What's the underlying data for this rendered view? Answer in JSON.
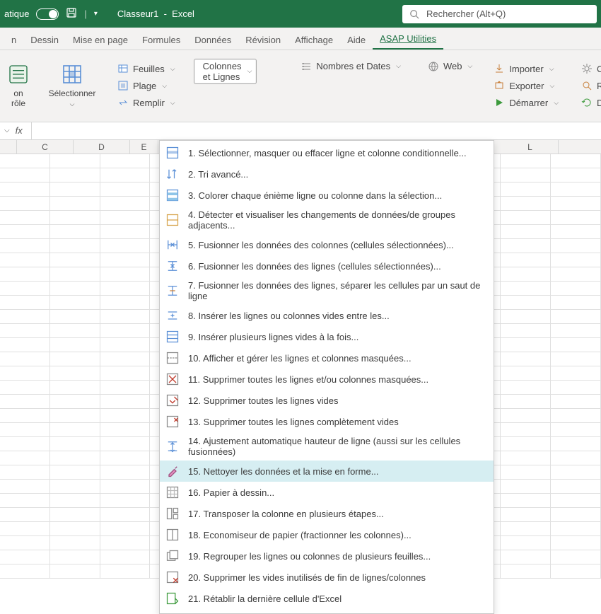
{
  "titlebar": {
    "left_label": "atique",
    "filename": "Classeur1",
    "app": "Excel",
    "search_placeholder": "Rechercher (Alt+Q)"
  },
  "tabs": {
    "t0": "n",
    "t1": "Dessin",
    "t2": "Mise en page",
    "t3": "Formules",
    "t4": "Données",
    "t5": "Révision",
    "t6": "Affichage",
    "t7": "Aide",
    "t8": "ASAP Utilities"
  },
  "ribbon": {
    "left_small1": "on",
    "left_small2": "rôle",
    "selectionner": "Sélectionner",
    "feuilles": "Feuilles",
    "plage": "Plage",
    "remplir": "Remplir",
    "colonnes": "Colonnes et Lignes",
    "nombres": "Nombres et Dates",
    "web": "Web",
    "importer": "Importer",
    "exporter": "Exporter",
    "demarrer": "Démarrer",
    "opt1": "C",
    "opt2": "R",
    "opt3": "D"
  },
  "columns": {
    "c1": "C",
    "c2": "D",
    "c3": "E",
    "c4": "L"
  },
  "menu": {
    "m1": "1. Sélectionner, masquer ou effacer ligne et colonne conditionnelle...",
    "m2": "2. Tri avancé...",
    "m3": "3. Colorer chaque énième ligne ou colonne dans la sélection...",
    "m4": "4. Détecter et visualiser les changements de données/de groupes adjacents...",
    "m5": "5. Fusionner les données des colonnes (cellules sélectionnées)...",
    "m6": "6. Fusionner les données des lignes  (cellules sélectionnées)...",
    "m7": "7. Fusionner les données des lignes, séparer les cellules par un saut de ligne",
    "m8": "8. Insérer les lignes ou colonnes vides entre les...",
    "m9": "9. Insérer plusieurs lignes vides à la fois...",
    "m10": "10. Afficher et gérer les lignes et colonnes masquées...",
    "m11": "11. Supprimer toutes les lignes et/ou colonnes masquées...",
    "m12": "12. Supprimer toutes les lignes vides",
    "m13": "13. Supprimer toutes les lignes complètement vides",
    "m14": "14. Ajustement automatique hauteur de ligne (aussi sur les cellules fusionnées)",
    "m15": "15. Nettoyer les données et la mise en forme...",
    "m16": "16. Papier à dessin...",
    "m17": "17. Transposer la colonne en plusieurs étapes...",
    "m18": "18. Economiseur de papier (fractionner les colonnes)...",
    "m19": "19. Regrouper les lignes ou colonnes de plusieurs feuilles...",
    "m20": "20. Supprimer les vides inutilisés de fin de lignes/colonnes",
    "m21": "21. Rétablir la dernière cellule d'Excel"
  }
}
